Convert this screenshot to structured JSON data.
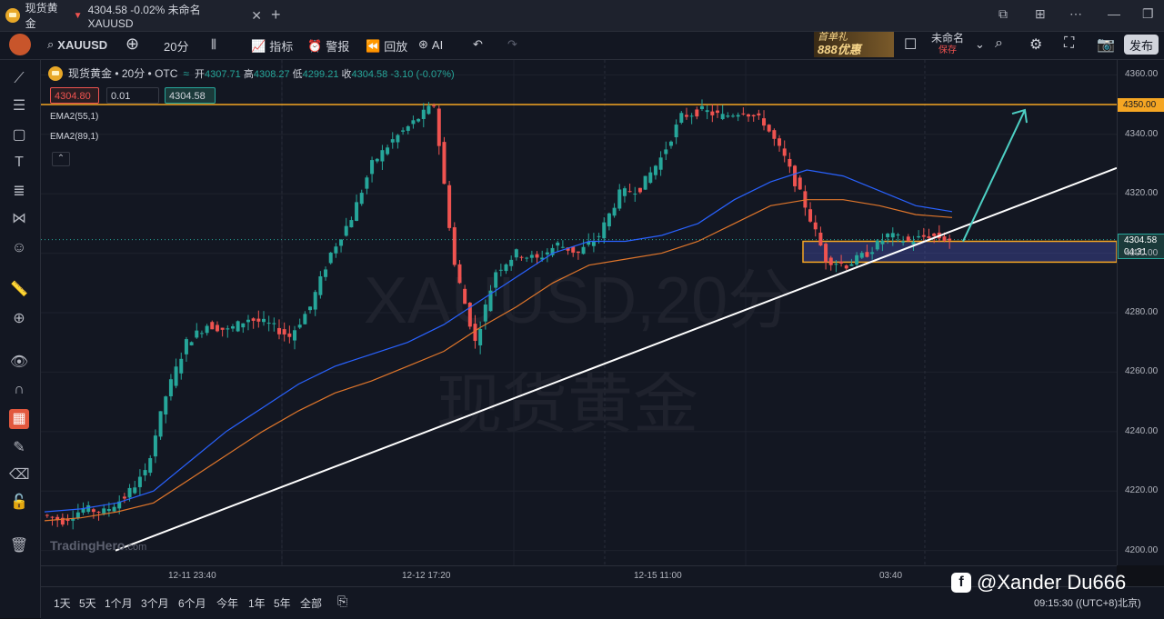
{
  "tab": {
    "title": "现货黄金",
    "summary": "4304.58 -0.02% 未命名 XAUUSD"
  },
  "toolbar": {
    "symbol": "XAUUSD",
    "interval": "20分",
    "indicators": "指标",
    "alert": "警报",
    "replay": "回放",
    "ai": "AI",
    "ad_line1": "首单礼",
    "ad_line2": "888优惠",
    "layout_name": "未命名",
    "layout_status": "保存",
    "publish": "发布"
  },
  "legend": {
    "title": "现货黄金 • 20分 • OTC",
    "open_label": "开",
    "open": "4307.71",
    "high_label": "高",
    "high": "4308.27",
    "low_label": "低",
    "low": "4299.21",
    "close_label": "收",
    "close": "4304.58",
    "change": "-3.10 (-0.07%)",
    "sell_price": "4304.80",
    "qty": "0.01",
    "buy_price": "4304.58",
    "ema1": "EMA2(55,1)",
    "ema2": "EMA2(89,1)"
  },
  "watermark": {
    "symbol": "XAUUSD,20分",
    "name": "现货黄金"
  },
  "brand": {
    "name": "TradingHero",
    "domain": ".com"
  },
  "price_axis": [
    "4360.00",
    "4350.00",
    "4340.00",
    "4320.00",
    "4300.00",
    "4280.00",
    "4260.00",
    "4240.00",
    "4220.00",
    "4200.00"
  ],
  "current_price": "4304.58",
  "countdown": "04:31",
  "time_axis": [
    "12-11 23:40",
    "12-12 17:20",
    "12-15 11:00",
    "03:40"
  ],
  "ranges": [
    "1天",
    "5天",
    "1个月",
    "3个月",
    "6个月",
    "今年",
    "1年",
    "5年",
    "全部"
  ],
  "social": "@Xander Du666",
  "clock": "09:15:30 ((UTC+8)北京)",
  "colors": {
    "up": "#26a69a",
    "down": "#ef5350",
    "ema55": "#2962ff",
    "ema89": "#e0762b",
    "resistance": "#f5a623",
    "trend": "#ffffff",
    "arrow": "#4dd0c4"
  },
  "chart_data": {
    "type": "candlestick",
    "symbol": "XAUUSD",
    "ylim": [
      4195,
      4365
    ],
    "x": [
      "12-11 23:40",
      "12-12 17:20",
      "12-15 11:00",
      "03:40"
    ],
    "close_series": [
      4212,
      4210,
      4214,
      4213,
      4218,
      4226,
      4252,
      4270,
      4276,
      4274,
      4278,
      4276,
      4272,
      4282,
      4300,
      4312,
      4330,
      4338,
      4344,
      4350,
      4296,
      4270,
      4294,
      4300,
      4298,
      4303,
      4300,
      4306,
      4320,
      4322,
      4332,
      4346,
      4348,
      4346,
      4348,
      4344,
      4332,
      4316,
      4298,
      4296,
      4300,
      4306,
      4304,
      4306,
      4304.58
    ],
    "ema55": [
      4213,
      4214,
      4216,
      4220,
      4230,
      4240,
      4248,
      4256,
      4262,
      4266,
      4270,
      4276,
      4284,
      4292,
      4300,
      4304,
      4304,
      4306,
      4310,
      4318,
      4324,
      4328,
      4326,
      4321,
      4316,
      4314
    ],
    "ema89": [
      4210,
      4211,
      4213,
      4216,
      4224,
      4232,
      4240,
      4247,
      4253,
      4257,
      4262,
      4267,
      4275,
      4282,
      4290,
      4296,
      4298,
      4300,
      4304,
      4310,
      4316,
      4318,
      4318,
      4316,
      4313,
      4312
    ],
    "resistance": 4350,
    "support_zone": [
      4297,
      4304
    ],
    "trendline": [
      {
        "x": "12-11 23:40",
        "y": 4200
      },
      {
        "x": "03:40",
        "y": 4304
      }
    ],
    "current": 4304.58
  }
}
